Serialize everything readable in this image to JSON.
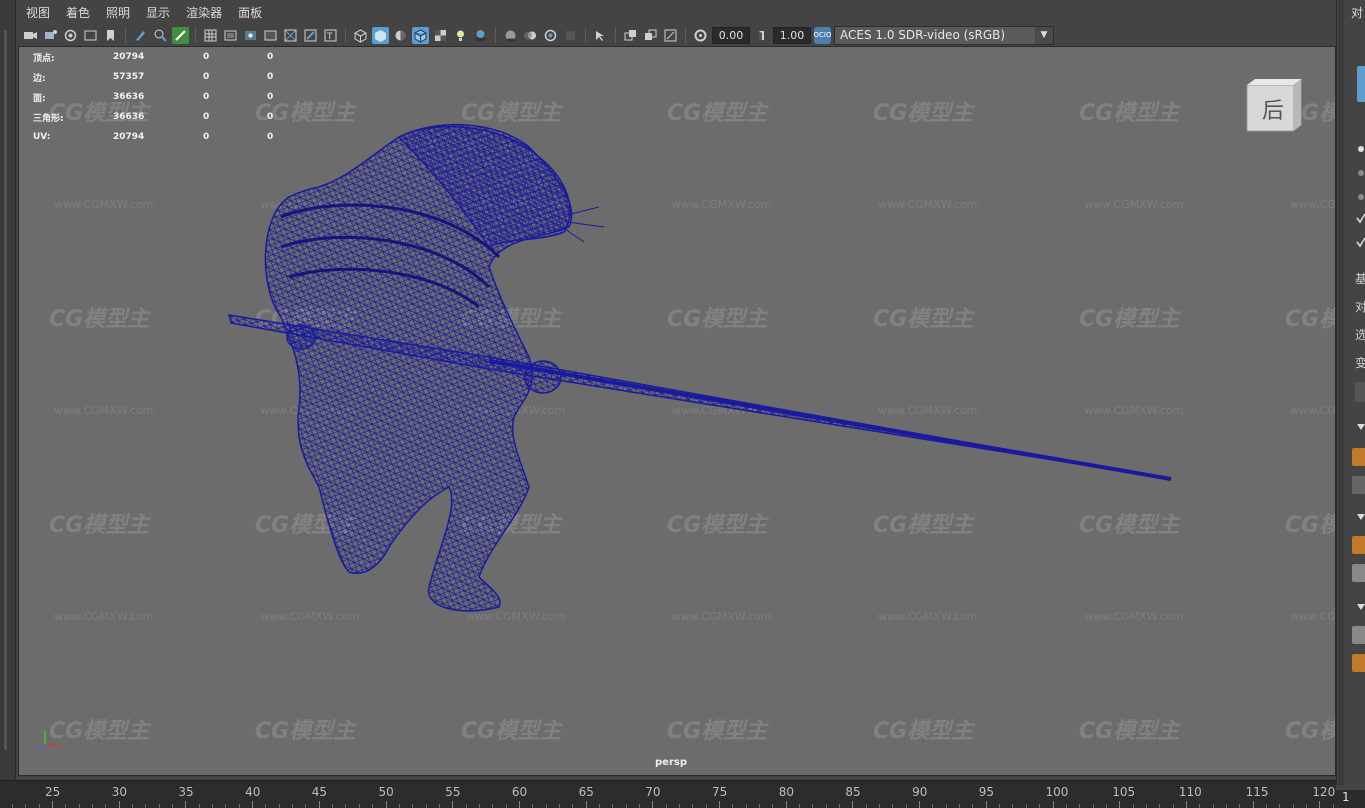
{
  "menu": [
    "视图",
    "着色",
    "照明",
    "显示",
    "渲染器",
    "面板"
  ],
  "toolbar": {
    "gamma_value": "0.00",
    "exposure_value": "1.00",
    "ocio_icon_text": "OCIO",
    "color_space": "ACES 1.0 SDR-video (sRGB)",
    "accent_color": "#5d9ecf"
  },
  "hud": {
    "rows": [
      {
        "label": "顶点:",
        "v1": "20794",
        "v2": "0",
        "v3": "0"
      },
      {
        "label": "边:",
        "v1": "57357",
        "v2": "0",
        "v3": "0"
      },
      {
        "label": "面:",
        "v1": "36636",
        "v2": "0",
        "v3": "0"
      },
      {
        "label": "三角形:",
        "v1": "36636",
        "v2": "0",
        "v3": "0"
      },
      {
        "label": "UV:",
        "v1": "20794",
        "v2": "0",
        "v3": "0"
      }
    ]
  },
  "viewport": {
    "camera_label": "persp",
    "viewcube_label": "后",
    "watermark_text": "CG模型主",
    "watermark_url": "www.CGMXW.com",
    "wireframe_color": "#1a1a9e"
  },
  "right_panel": {
    "title": "对",
    "items": [
      "基",
      "对",
      "选",
      "变"
    ]
  },
  "timeline": {
    "labels": [
      "25",
      "30",
      "35",
      "40",
      "45",
      "50",
      "55",
      "60",
      "65",
      "70",
      "75",
      "80",
      "85",
      "90",
      "95",
      "100",
      "105",
      "110",
      "115",
      "120"
    ],
    "current_frame": "1"
  }
}
